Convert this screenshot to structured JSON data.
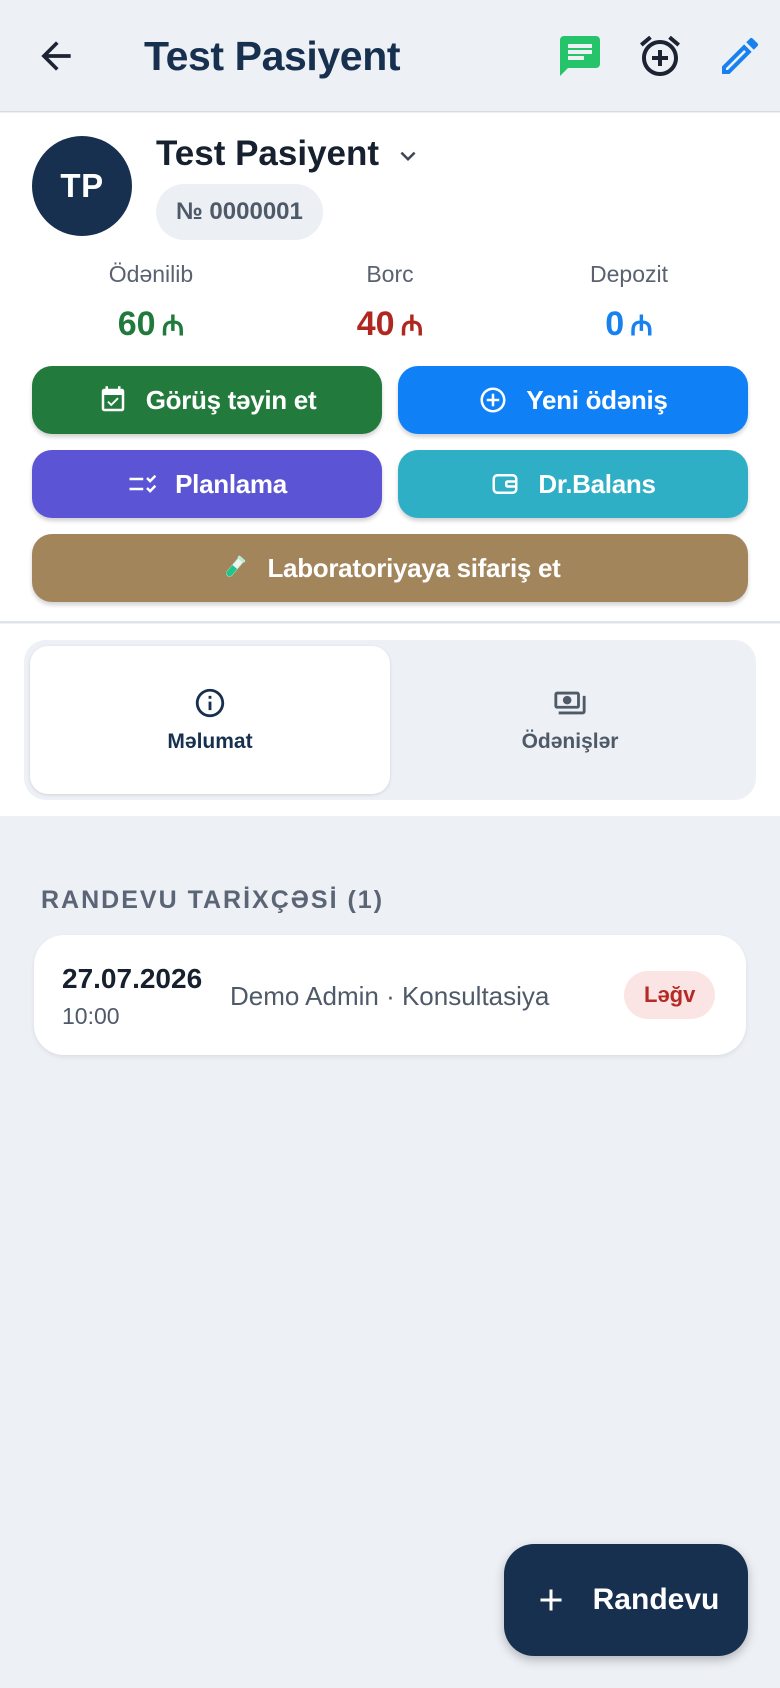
{
  "header": {
    "title": "Test Pasiyent",
    "back_icon": "arrow-left-icon",
    "actions": [
      {
        "name": "message-icon",
        "color": "#25c36a"
      },
      {
        "name": "alarm-add-icon",
        "color": "#17304f"
      },
      {
        "name": "edit-pencil-icon",
        "color": "#1681ef"
      }
    ]
  },
  "patient": {
    "initials": "TP",
    "name": "Test Pasiyent",
    "number": "№ 0000001",
    "avatar_color": "#17304f"
  },
  "stats": {
    "paid": {
      "label": "Ödənilib",
      "value": "60",
      "currency": "₼",
      "color": "#1f7a3b"
    },
    "debt": {
      "label": "Borc",
      "value": "40",
      "currency": "₼",
      "color": "#b0271f"
    },
    "deposit": {
      "label": "Depozit",
      "value": "0",
      "currency": "₼",
      "color": "#1681ef"
    }
  },
  "actions": {
    "appointment": {
      "label": "Görüş təyin et",
      "icon": "calendar-check-icon",
      "color": "#227b3c"
    },
    "new_payment": {
      "label": "Yeni ödəniş",
      "icon": "plus-circle-icon",
      "color": "#1080f6"
    },
    "planning": {
      "label": "Planlama",
      "icon": "checklist-icon",
      "color": "#5b55d6"
    },
    "dr_balance": {
      "label": "Dr.Balans",
      "icon": "wallet-icon",
      "color": "#2fafc6"
    },
    "lab_order": {
      "label": "Laboratoriyaya sifariş et",
      "icon": "test-tube-icon",
      "color": "#a3855c"
    }
  },
  "tabs": [
    {
      "label": "Məlumat",
      "icon": "info-icon",
      "active": true
    },
    {
      "label": "Ödənişlər",
      "icon": "payments-icon",
      "active": false
    }
  ],
  "history": {
    "title": "RANDEVU TARİXÇƏSİ (1)",
    "items": [
      {
        "date": "27.07.2026",
        "time": "10:00",
        "description": "Demo Admin · Konsultasiya",
        "status": "Ləğv"
      }
    ]
  },
  "fab": {
    "label": "Randevu",
    "icon": "plus-icon"
  }
}
